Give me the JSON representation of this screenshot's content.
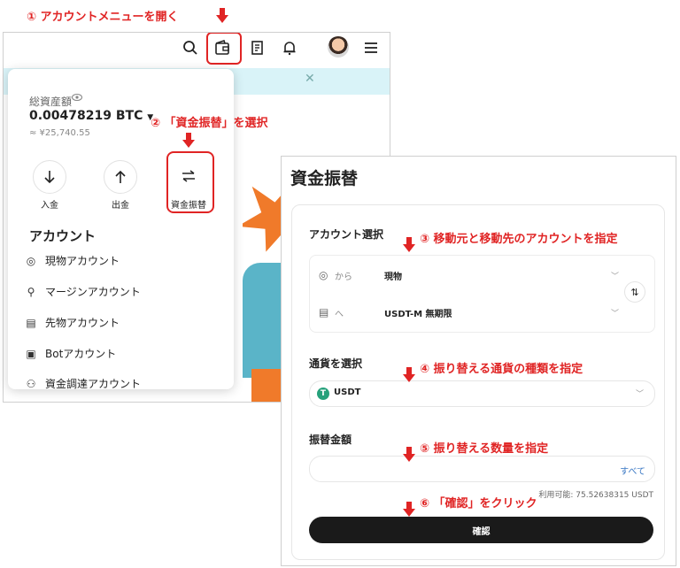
{
  "annotations": {
    "step1": "① アカウントメニューを開く",
    "step2": "② 「資金振替」を選択",
    "step3": "③ 移動元と移動先のアカウントを指定",
    "step4": "④ 振り替える通貨の種類を指定",
    "step5": "⑤ 振り替える数量を指定",
    "step6": "⑥ 「確認」をクリック"
  },
  "topbar": {
    "icons": [
      "search-icon",
      "wallet-icon",
      "orders-icon",
      "bell-icon",
      "avatar",
      "menu-icon"
    ]
  },
  "account_menu": {
    "total_assets_label": "総資産額",
    "btc_balance": "0.00478219 BTC",
    "jpy_balance": "≈ ¥25,740.55",
    "actions": [
      {
        "label": "入金",
        "icon": "arrow-down-icon"
      },
      {
        "label": "出金",
        "icon": "arrow-up-icon"
      },
      {
        "label": "資金振替",
        "icon": "transfer-icon"
      }
    ],
    "section_title": "アカウント",
    "accounts": [
      {
        "label": "現物アカウント",
        "icon": "spot-icon"
      },
      {
        "label": "マージンアカウント",
        "icon": "margin-icon"
      },
      {
        "label": "先物アカウント",
        "icon": "futures-icon"
      },
      {
        "label": "Botアカウント",
        "icon": "bot-icon"
      },
      {
        "label": "資金調達アカウント",
        "icon": "funding-icon"
      }
    ]
  },
  "transfer_panel": {
    "title": "資金振替",
    "account_select_label": "アカウント選択",
    "from_label": "から",
    "from_value": "現物",
    "to_label": "へ",
    "to_value": "USDT-M 無期限",
    "currency_label": "通貨を選択",
    "currency_value": "USDT",
    "amount_label": "振替金額",
    "amount_all": "すべて",
    "available_text": "利用可能:  75.52638315  USDT",
    "confirm_label": "確認"
  },
  "colors": {
    "annotation_red": "#e02424",
    "banner_cyan": "#d9f3f8",
    "tether_green": "#26a17b",
    "confirm_black": "#1a1a1a"
  }
}
